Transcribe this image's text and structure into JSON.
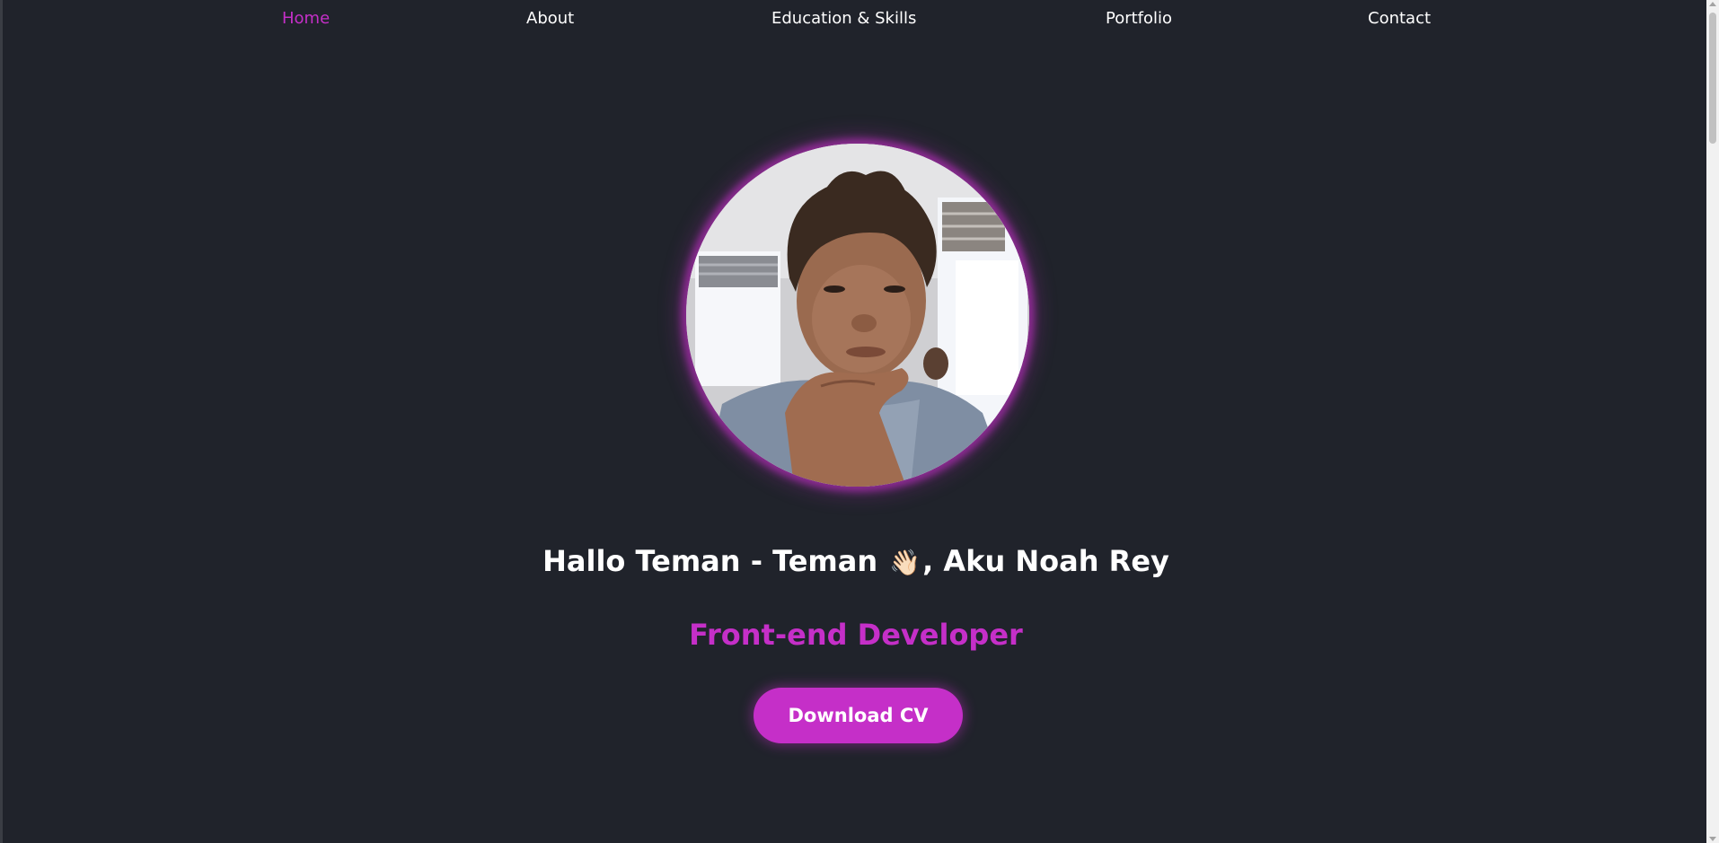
{
  "nav": {
    "items": [
      {
        "label": "Home",
        "active": true
      },
      {
        "label": "About",
        "active": false
      },
      {
        "label": "Education & Skills",
        "active": false
      },
      {
        "label": "Portfolio",
        "active": false
      },
      {
        "label": "Contact",
        "active": false
      }
    ]
  },
  "hero": {
    "greeting_prefix": "Hallo Teman - Teman",
    "wave_emoji": "👋🏻",
    "greeting_suffix": ", Aku Noah Rey",
    "role": "Front-end Developer",
    "cta_label": "Download CV"
  },
  "colors": {
    "background": "#20232b",
    "accent": "#c52fc8",
    "text": "#ffffff"
  }
}
